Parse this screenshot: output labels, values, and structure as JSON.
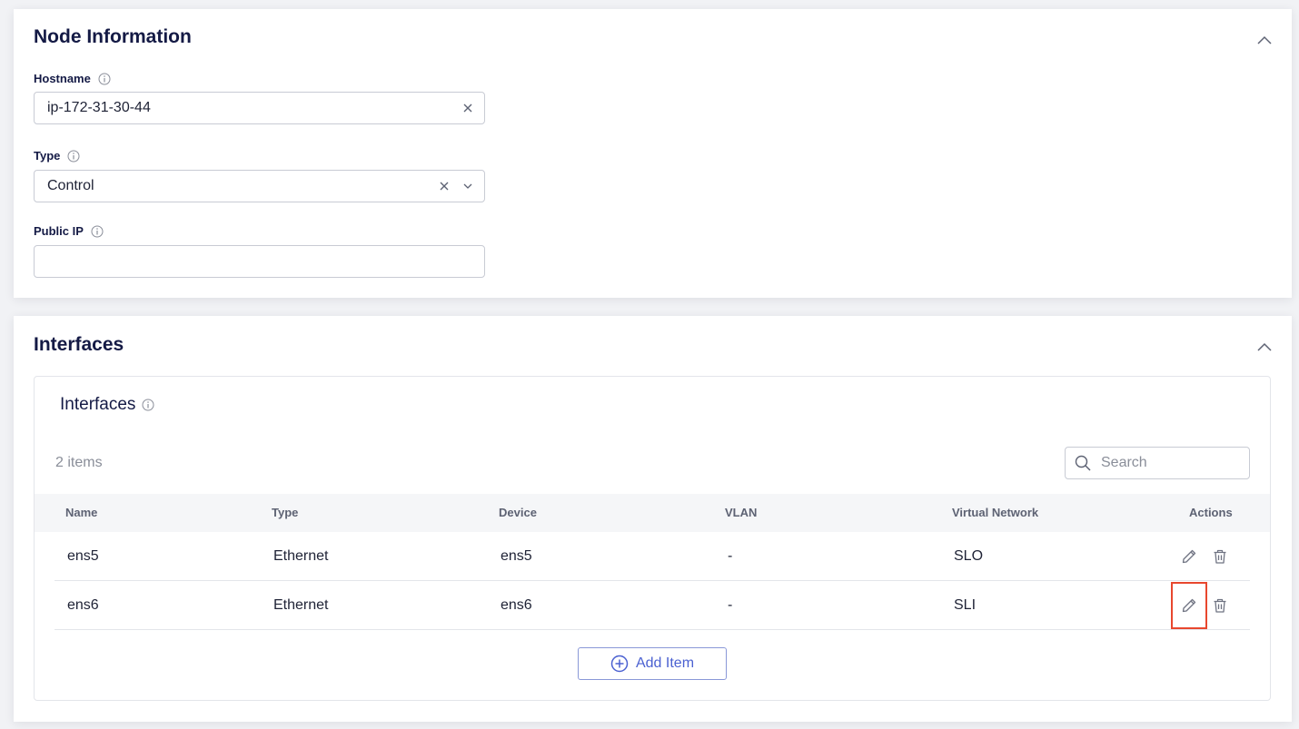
{
  "node_information": {
    "title": "Node Information",
    "hostname": {
      "label": "Hostname",
      "value": "ip-172-31-30-44"
    },
    "type": {
      "label": "Type",
      "value": "Control"
    },
    "public_ip": {
      "label": "Public IP",
      "value": ""
    }
  },
  "interfaces_section": {
    "title": "Interfaces",
    "inner_title": "Interfaces",
    "items_count": "2 items",
    "search": {
      "placeholder": "Search"
    },
    "table": {
      "columns": [
        "Name",
        "Type",
        "Device",
        "VLAN",
        "Virtual Network",
        "Actions"
      ],
      "rows": [
        {
          "name": "ens5",
          "type": "Ethernet",
          "device": "ens5",
          "vlan": "-",
          "virtual_network": "SLO"
        },
        {
          "name": "ens6",
          "type": "Ethernet",
          "device": "ens6",
          "vlan": "-",
          "virtual_network": "SLI"
        }
      ]
    },
    "add_item_label": "Add Item"
  },
  "icons": {
    "collapse": "chevron-up-icon",
    "info": "info-icon",
    "clear": "close-icon",
    "dropdown": "chevron-down-icon",
    "search": "search-icon",
    "edit": "pencil-icon",
    "delete": "trash-icon",
    "add": "plus-circle-icon"
  },
  "colors": {
    "title": "#141a45",
    "accent": "#4b61d1",
    "highlight_border": "#e8472e",
    "muted_text": "#8a8e99"
  }
}
